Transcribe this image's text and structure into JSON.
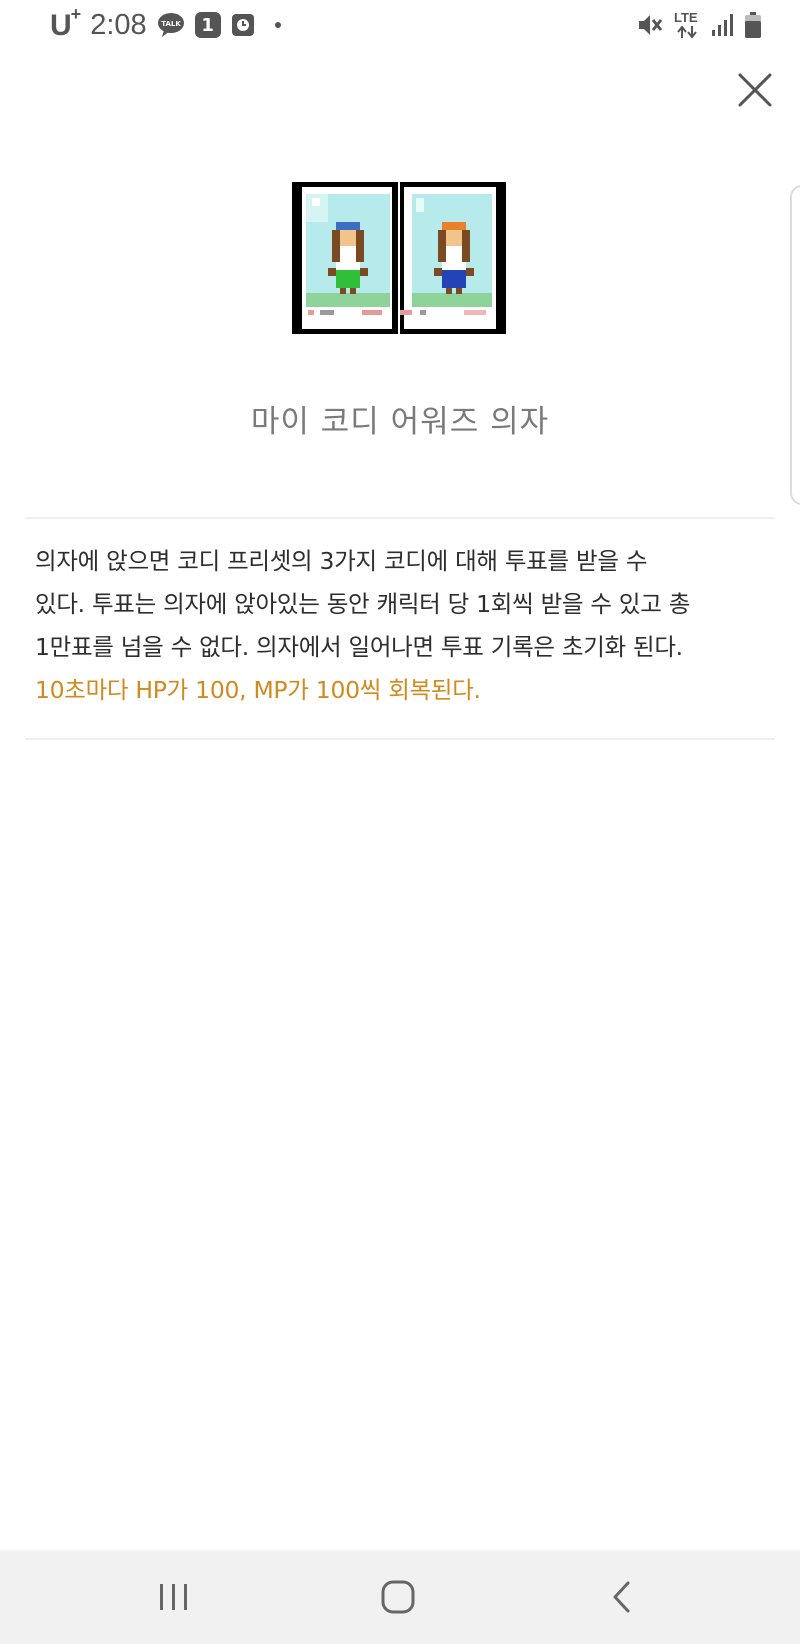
{
  "status_bar": {
    "carrier": "U",
    "carrier_plus": "+",
    "time": "2:08",
    "notification_count": "1",
    "network": "LTE"
  },
  "item": {
    "title": "마이 코디 어워즈 의자",
    "description_lines": [
      "의자에 앉으면 코디 프리셋의 3가지 코디에 대해 투표를 받을 수",
      "있다. 투표는 의자에 앉아있는 동안 캐릭터 당 1회씩 받을 수 있고 총",
      "1만표를 넘을 수 없다. 의자에서 일어나면 투표 기록은 초기화 된다."
    ],
    "effect_text": "10초마다 HP가 100, MP가 100씩 회복된다."
  },
  "colors": {
    "effect": "#d08a1e",
    "nav_background": "#f1f1f1"
  },
  "icons": {
    "close": "close-icon",
    "nav_recents": "recents-icon",
    "nav_home": "home-icon",
    "nav_back": "back-icon"
  }
}
